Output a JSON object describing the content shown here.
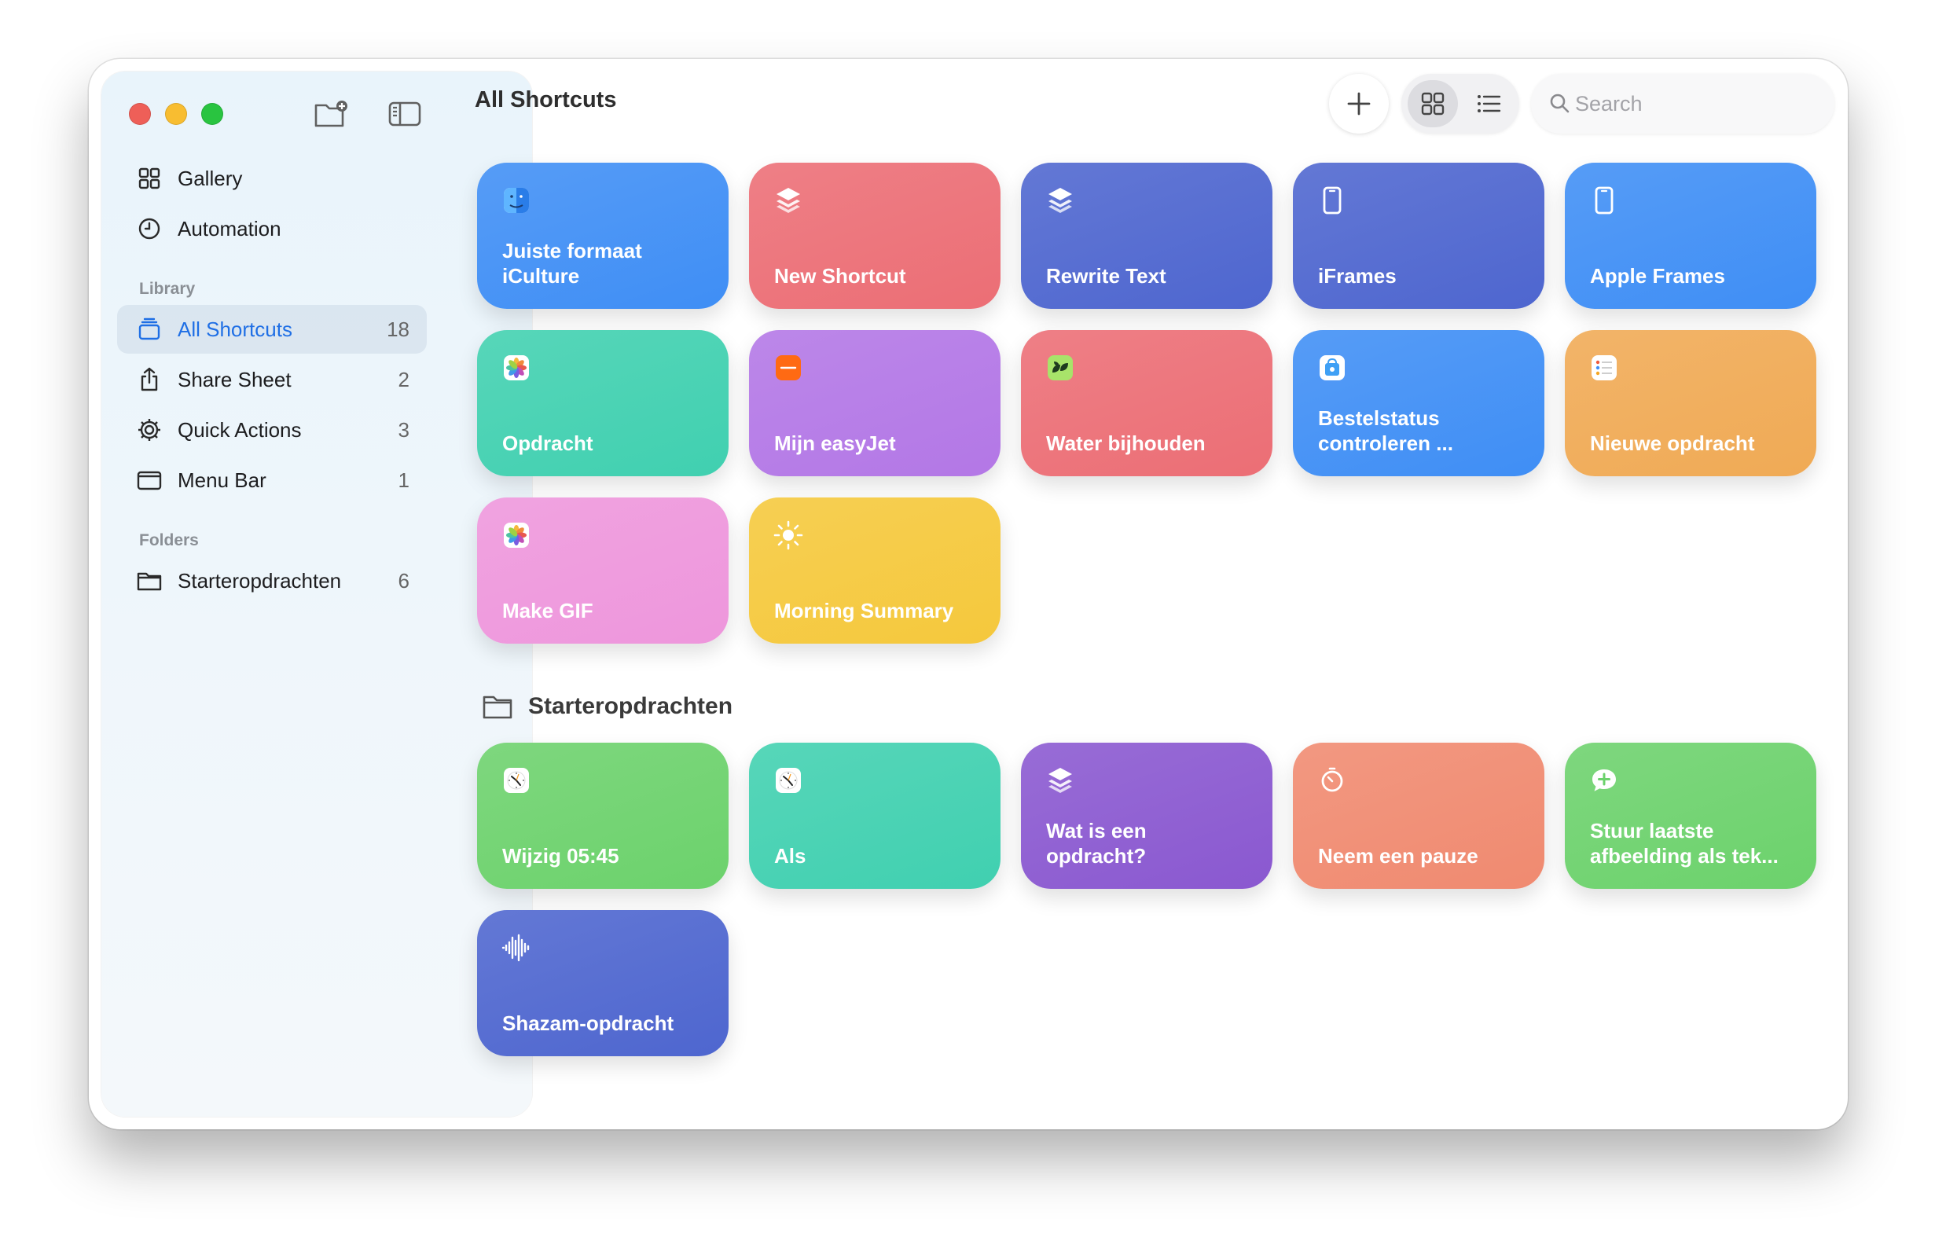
{
  "window": {
    "title": "All Shortcuts"
  },
  "sidebar": {
    "top_items": [
      {
        "label": "Gallery",
        "icon": "grid-icon"
      },
      {
        "label": "Automation",
        "icon": "clock-icon"
      }
    ],
    "library_label": "Library",
    "library_items": [
      {
        "label": "All Shortcuts",
        "count": "18",
        "icon": "stack-icon",
        "active": true
      },
      {
        "label": "Share Sheet",
        "count": "2",
        "icon": "share-icon"
      },
      {
        "label": "Quick Actions",
        "count": "3",
        "icon": "gear-icon"
      },
      {
        "label": "Menu Bar",
        "count": "1",
        "icon": "menubar-icon"
      }
    ],
    "folders_label": "Folders",
    "folder_items": [
      {
        "label": "Starteropdrachten",
        "count": "6",
        "icon": "folder-icon"
      }
    ]
  },
  "toolbar": {
    "search_placeholder": "Search"
  },
  "shortcuts": [
    {
      "label": "Juiste formaat\niCulture",
      "icon": "finder-icon",
      "color": "#3f8ef5"
    },
    {
      "label": "New Shortcut",
      "icon": "layers-icon",
      "color": "#ec6e75"
    },
    {
      "label": "Rewrite Text",
      "icon": "layers-icon",
      "color": "#4e66cf"
    },
    {
      "label": "iFrames",
      "icon": "phone-icon",
      "color": "#4e66cf"
    },
    {
      "label": "Apple Frames",
      "icon": "phone-icon",
      "color": "#3f8ef5"
    },
    {
      "label": "Opdracht",
      "icon": "photos-icon",
      "color": "#40d0b0"
    },
    {
      "label": "Mijn easyJet",
      "icon": "easyjet-icon",
      "color": "#b377e6"
    },
    {
      "label": "Water bijhouden",
      "icon": "leaf-app-icon",
      "color": "#ec6e75"
    },
    {
      "label": "Bestelstatus\ncontroleren ...",
      "icon": "apple-store-icon",
      "color": "#3f8ef5"
    },
    {
      "label": "Nieuwe opdracht",
      "icon": "reminders-icon",
      "color": "#f0aa55"
    },
    {
      "label": "Make GIF",
      "icon": "photos-icon",
      "color": "#ee96dc"
    },
    {
      "label": "Morning Summary",
      "icon": "sun-icon",
      "color": "#f5c83c"
    }
  ],
  "folder": {
    "name": "Starteropdrachten",
    "shortcuts": [
      {
        "label": "Wijzig 05:45",
        "icon": "clock-app-icon",
        "color": "#6cd26c"
      },
      {
        "label": "Als",
        "icon": "clock-app-icon",
        "color": "#40d0b0"
      },
      {
        "label": "Wat is een\nopdracht?",
        "icon": "layers-icon",
        "color": "#8a58d0"
      },
      {
        "label": "Neem een pauze",
        "icon": "timer-icon",
        "color": "#f08a70"
      },
      {
        "label": "Stuur laatste\nafbeelding als tek...",
        "icon": "message-plus-icon",
        "color": "#6cd26c"
      },
      {
        "label": "Shazam-opdracht",
        "icon": "waveform-icon",
        "color": "#4e66cf"
      }
    ]
  }
}
